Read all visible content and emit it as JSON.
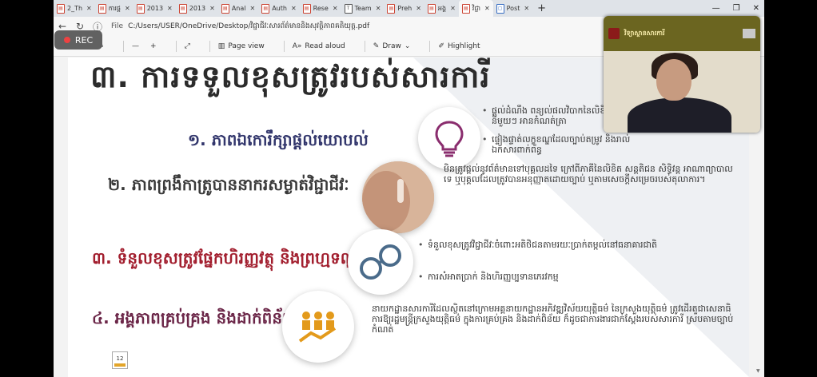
{
  "tabs": [
    {
      "label": "2_Th",
      "kind": "pdf"
    },
    {
      "label": "ការផ្ត",
      "kind": "pdf"
    },
    {
      "label": "2013",
      "kind": "pdf"
    },
    {
      "label": "2013",
      "kind": "pdf"
    },
    {
      "label": "Anal",
      "kind": "pdf"
    },
    {
      "label": "Auth",
      "kind": "pdf"
    },
    {
      "label": "Rese",
      "kind": "pdf"
    },
    {
      "label": "Team",
      "kind": "teams"
    },
    {
      "label": "Preh",
      "kind": "pdf"
    },
    {
      "label": "អង្គ",
      "kind": "pdf"
    },
    {
      "label": "វិជ្ជា",
      "kind": "pdf",
      "active": true
    },
    {
      "label": "Post",
      "kind": "blue"
    }
  ],
  "address": {
    "file_label": "File",
    "url": "C:/Users/USER/OneDrive/Desktop/វិជ្ជាជីវៈសារព័ត៌មាននិងសុវត្ថិភាពគតិយុត្ត.pdf"
  },
  "pdf_toolbar": {
    "page_view": "Page view",
    "read_aloud": "Read aloud",
    "draw": "Draw",
    "highlight": "Highlight"
  },
  "rec": {
    "label": "REC"
  },
  "slide": {
    "title": "៣. ការទទួលខុសត្រូវរបស់សារការី",
    "items": [
      {
        "heading": "១. ភាពឯកោរឹក្សាផ្តល់យោបល់"
      },
      {
        "heading": "២. ភាពព្រងឹកាត្រូបាននាករសម្ងាត់វិជ្ជាជីវៈ"
      },
      {
        "heading": "៣. ទំនួលខុសត្រូវផ្នែកហិរញ្ញវត្ថុ និងព្រហ្មទណ្ឌ"
      },
      {
        "heading": "៤. អង្គភាពគ្រប់គ្រង និងដាក់ពិន័យ"
      }
    ],
    "bullets_1": [
      "ផ្តល់ដំណឹង ពន្យល់ផលវិបាកនៃលិខិតនីមួយៗ អានកំណត់ត្រា",
      "ផ្ទៀងផ្ទាត់លក្ខខណ្ឌដែលច្បាប់តម្រូវ និងរាល់ឯកសារពាក់ព័ន្ធ"
    ],
    "para_2": "មិនត្រូវផ្តល់នូវព័ត៌មានទៅបុគ្គលដទៃ ក្រៅពីភាគីនៃលិខិត សន្តតិជន សិទ្ធិវន្ត អាណាព្យាបាល ទេ ឬបុគ្គលដែលត្រូវបានអនុញ្ញាតដោយច្បាប់ ឬតាមសេចក្តីសម្រេចរបស់តុលាការ។",
    "bullets_3": [
      "ទំនួលខុសត្រូវវិជ្ជាជីវៈចំពោះអតិថិជនតាមរយៈប្រាក់តម្កល់នៅធនាគារជាតិ",
      "ការសំអាតប្រាក់ និងហិរញ្ញប្បទានភេរវកម្ម"
    ],
    "para_4": "នាយកដ្ឋានសារការីដែលស្ថិតនៅក្រោមអគ្គនាយកដ្ឋានអភិវឌ្ឍវិស័យយុត្តិធម៌ នៃក្រសួងយុត្តិធម៌ ត្រូវដើរតួជាសេនាធិការឱ្យរដ្ឋមន្ត្រីក្រសួងយុត្តិធម៌ ក្នុងការគ្រប់គ្រង និងដាក់ពិន័យ ក៏ដូចជាការងារជាក់ស្តែងរបស់សារការី ស្របតាមច្បាប់កំណត់",
    "page_number": "12"
  },
  "video": {
    "banner_text": "វិទ្យាស្ថានសារការី"
  }
}
